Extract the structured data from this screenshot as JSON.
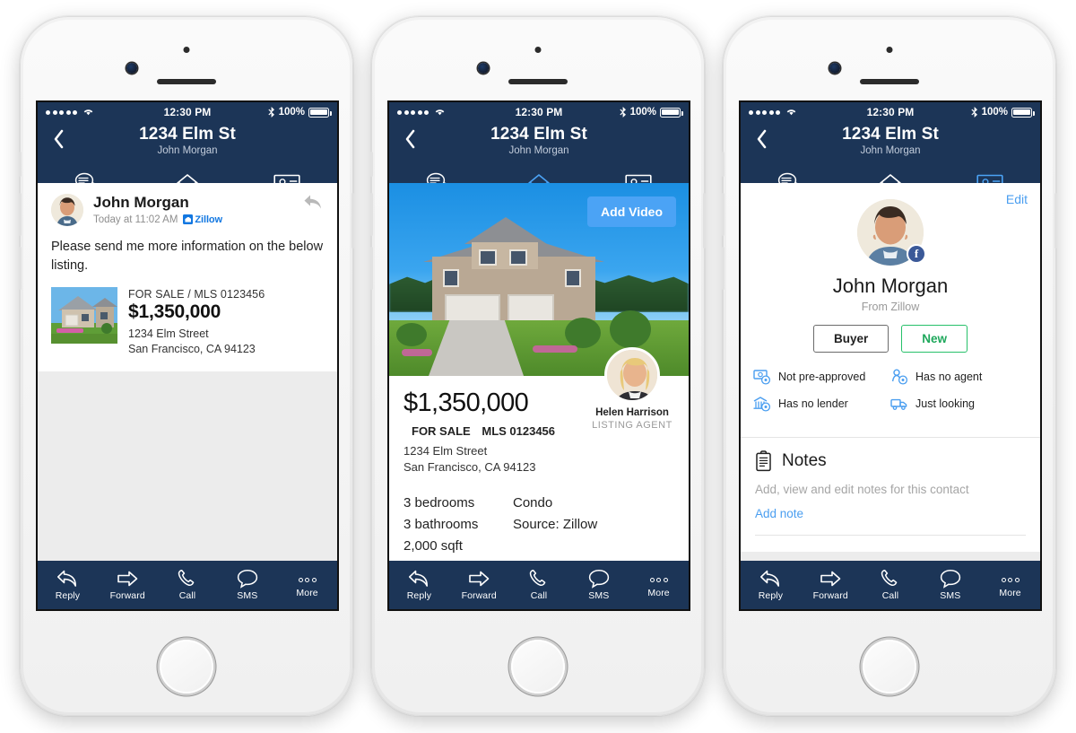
{
  "status_bar": {
    "time": "12:30 PM",
    "battery": "100%",
    "signal_dots": 5
  },
  "nav": {
    "title": "1234 Elm St",
    "subtitle": "John Morgan",
    "back_icon": "chevron-left-icon"
  },
  "tabs": [
    {
      "name": "messages",
      "icon": "chat-bubbles-icon"
    },
    {
      "name": "property",
      "icon": "house-icon"
    },
    {
      "name": "contact",
      "icon": "contact-card-icon"
    }
  ],
  "toolbar": [
    {
      "label": "Reply",
      "icon": "reply-arrow-icon"
    },
    {
      "label": "Forward",
      "icon": "forward-arrow-icon"
    },
    {
      "label": "Call",
      "icon": "phone-icon"
    },
    {
      "label": "SMS",
      "icon": "speech-bubble-icon"
    },
    {
      "label": "More",
      "icon": "ellipsis-icon"
    }
  ],
  "phone1": {
    "active_tab": 0,
    "message": {
      "sender": "John Morgan",
      "timestamp": "Today at 11:02 AM",
      "source_badge": "Zillow",
      "body": "Please send me more information on the below listing.",
      "reply_icon": "reply-arrow-icon"
    },
    "listing": {
      "status": "FOR SALE / MLS 0123456",
      "price": "$1,350,000",
      "address_line1": "1234 Elm Street",
      "address_line2": "San Francisco, CA 94123"
    }
  },
  "phone2": {
    "active_tab": 1,
    "add_video_label": "Add Video",
    "agent": {
      "name": "Helen Harrison",
      "role": "LISTING AGENT"
    },
    "property": {
      "price": "$1,350,000",
      "status": "FOR SALE",
      "mls": "MLS 0123456",
      "address_line1": "1234 Elm Street",
      "address_line2": "San Francisco, CA 94123",
      "specs_left": [
        "3 bedrooms",
        "3 bathrooms",
        "2,000 sqft"
      ],
      "specs_right": [
        "Condo",
        "Source: Zillow"
      ]
    }
  },
  "phone3": {
    "active_tab": 2,
    "edit_label": "Edit",
    "contact": {
      "name": "John Morgan",
      "from": "From Zillow",
      "social_badge": "facebook-icon",
      "pills": [
        {
          "label": "Buyer",
          "style": "buyer"
        },
        {
          "label": "New",
          "style": "new"
        }
      ],
      "attributes": [
        {
          "label": "Not pre-approved",
          "icon": "money-off-icon"
        },
        {
          "label": "Has no agent",
          "icon": "person-off-icon"
        },
        {
          "label": "Has no lender",
          "icon": "bank-off-icon"
        },
        {
          "label": "Just looking",
          "icon": "truck-icon"
        }
      ]
    },
    "notes": {
      "title": "Notes",
      "icon": "clipboard-icon",
      "description": "Add, view and edit notes for this contact",
      "add_label": "Add note"
    }
  },
  "colors": {
    "navy": "#1c3557",
    "accent_blue": "#1f8ced",
    "link_blue": "#4a9ef0",
    "green": "#27c06a",
    "zillow_blue": "#1277e1"
  }
}
